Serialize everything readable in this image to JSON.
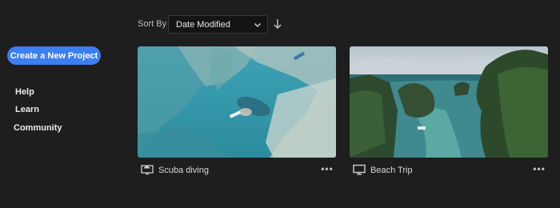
{
  "sidebar": {
    "create_label": "Create a New Project",
    "items": [
      {
        "label": "Help"
      },
      {
        "label": "Learn"
      },
      {
        "label": "Community"
      }
    ]
  },
  "toolbar": {
    "sort_label": "Sort By",
    "sort_value": "Date Modified",
    "sort_direction_icon": "arrow-down-icon"
  },
  "projects": [
    {
      "title": "Scuba diving",
      "type_icon": "cloud-monitor-icon",
      "thumbnail": "underwater cave with diver"
    },
    {
      "title": "Beach Trip",
      "type_icon": "monitor-icon",
      "thumbnail": "aerial view of islands and lagoon"
    }
  ],
  "colors": {
    "background": "#1e1e1e",
    "accent": "#3b7ff0"
  }
}
